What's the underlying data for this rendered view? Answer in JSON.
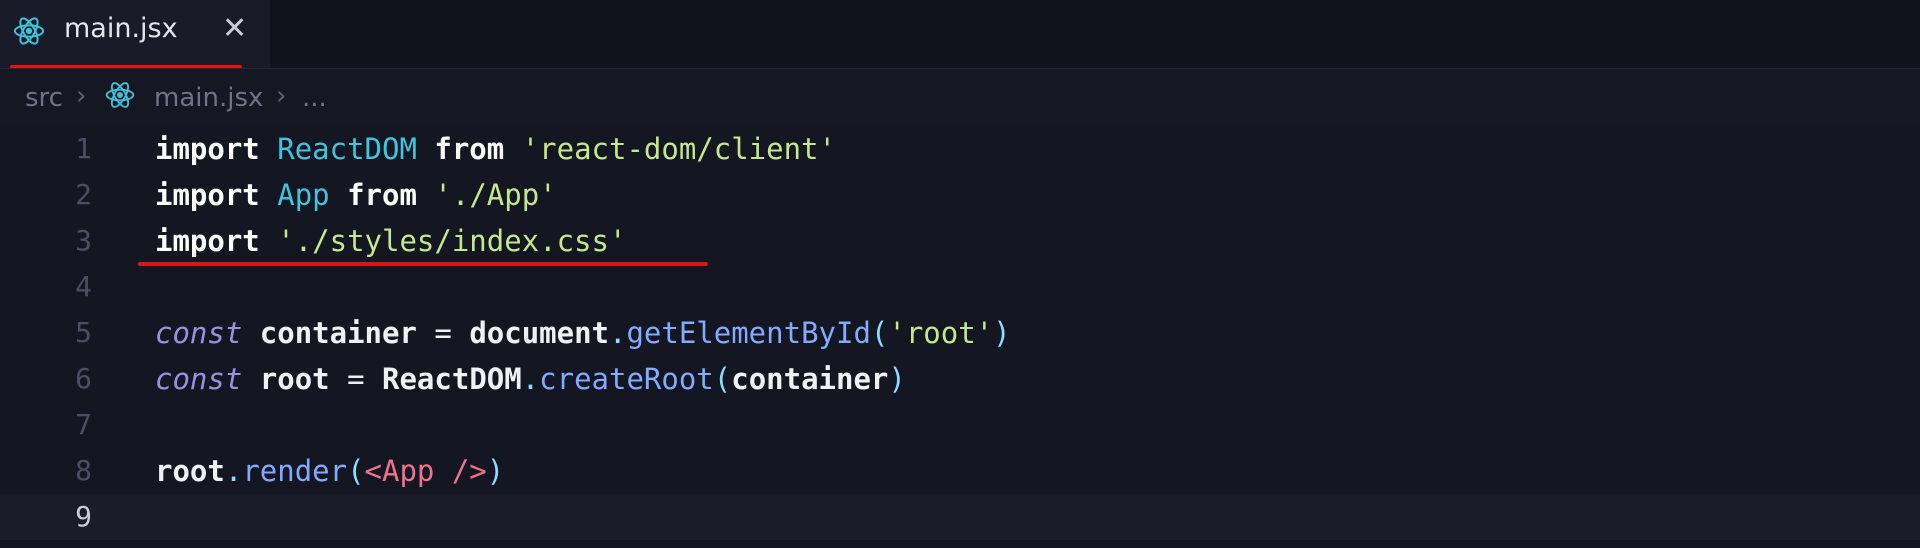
{
  "tab": {
    "label": "main.jsx",
    "close": "✕"
  },
  "breadcrumb": {
    "folder": "src",
    "file": "main.jsx",
    "more": "..."
  },
  "editor": {
    "line_numbers": [
      "1",
      "2",
      "3",
      "4",
      "5",
      "6",
      "7",
      "8",
      "9"
    ],
    "lines": [
      [
        {
          "t": "import",
          "c": "kw"
        },
        {
          "t": " ",
          "c": "plain"
        },
        {
          "t": "ReactDOM",
          "c": "cls"
        },
        {
          "t": " ",
          "c": "plain"
        },
        {
          "t": "from",
          "c": "kw"
        },
        {
          "t": " ",
          "c": "plain"
        },
        {
          "t": "'react-dom/client'",
          "c": "str"
        }
      ],
      [
        {
          "t": "import",
          "c": "kw"
        },
        {
          "t": " ",
          "c": "plain"
        },
        {
          "t": "App",
          "c": "cls"
        },
        {
          "t": " ",
          "c": "plain"
        },
        {
          "t": "from",
          "c": "kw"
        },
        {
          "t": " ",
          "c": "plain"
        },
        {
          "t": "'./App'",
          "c": "str"
        }
      ],
      [
        {
          "t": "import",
          "c": "kw"
        },
        {
          "t": " ",
          "c": "plain"
        },
        {
          "t": "'./styles/index.css'",
          "c": "str"
        }
      ],
      [],
      [
        {
          "t": "const",
          "c": "kw-it"
        },
        {
          "t": " ",
          "c": "plain"
        },
        {
          "t": "container",
          "c": "var"
        },
        {
          "t": " = ",
          "c": "plain"
        },
        {
          "t": "document",
          "c": "var"
        },
        {
          "t": ".",
          "c": "punc"
        },
        {
          "t": "getElementById",
          "c": "fn"
        },
        {
          "t": "(",
          "c": "punc"
        },
        {
          "t": "'root'",
          "c": "str"
        },
        {
          "t": ")",
          "c": "punc"
        }
      ],
      [
        {
          "t": "const",
          "c": "kw-it"
        },
        {
          "t": " ",
          "c": "plain"
        },
        {
          "t": "root",
          "c": "var"
        },
        {
          "t": " = ",
          "c": "plain"
        },
        {
          "t": "ReactDOM",
          "c": "var"
        },
        {
          "t": ".",
          "c": "punc"
        },
        {
          "t": "createRoot",
          "c": "fn"
        },
        {
          "t": "(",
          "c": "punc"
        },
        {
          "t": "container",
          "c": "var"
        },
        {
          "t": ")",
          "c": "punc"
        }
      ],
      [],
      [
        {
          "t": "root",
          "c": "var"
        },
        {
          "t": ".",
          "c": "punc"
        },
        {
          "t": "render",
          "c": "fn"
        },
        {
          "t": "(",
          "c": "punc"
        },
        {
          "t": "<App />",
          "c": "tag"
        },
        {
          "t": ")",
          "c": "punc"
        }
      ],
      []
    ],
    "current_line": 9
  },
  "icons": {
    "file_icon": "react-icon"
  }
}
